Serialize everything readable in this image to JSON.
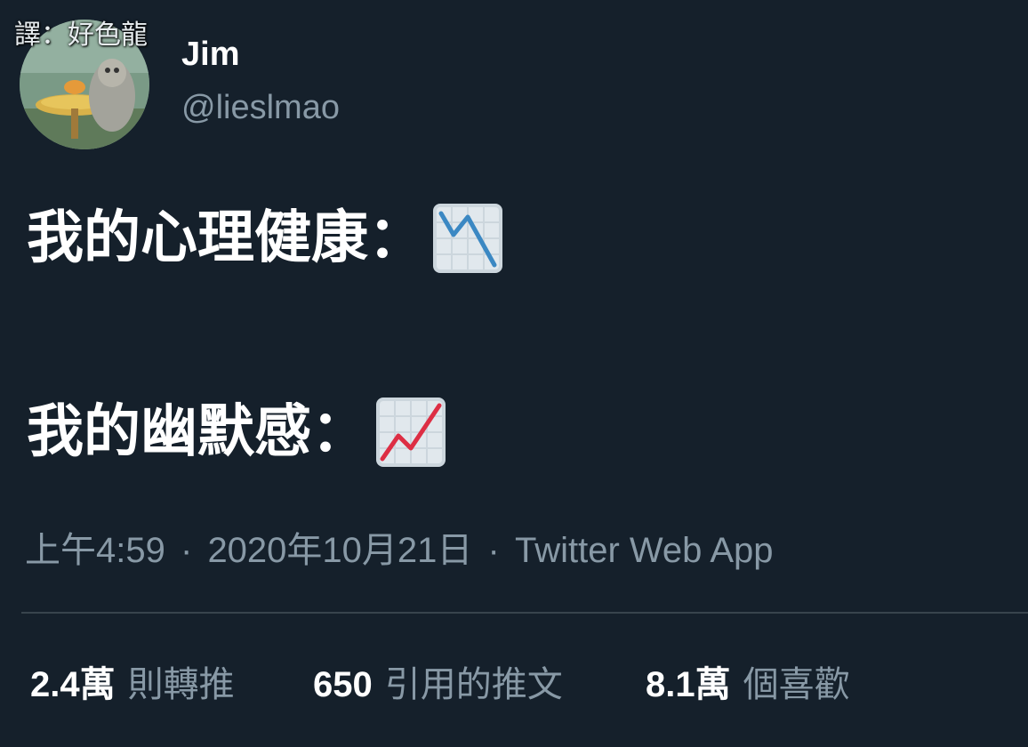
{
  "watermark": "譯：好色龍",
  "user": {
    "display_name": "Jim",
    "handle": "@lieslmao"
  },
  "tweet": {
    "line1": "我的心理健康：",
    "line1_emoji": "chart-decreasing-icon",
    "line2": "我的幽默感：",
    "line2_emoji": "chart-increasing-icon"
  },
  "meta": {
    "time": "上午4:59",
    "separator": "·",
    "date": "2020年10月21日",
    "source": "Twitter Web App"
  },
  "stats": {
    "retweets_count": "2.4萬",
    "retweets_label": "則轉推",
    "quotes_count": "650",
    "quotes_label": "引用的推文",
    "likes_count": "8.1萬",
    "likes_label": "個喜歡"
  },
  "colors": {
    "background": "#15202b",
    "secondary_text": "#8899a6",
    "divider": "#38444d",
    "chart_down": "#3b88c3",
    "chart_up": "#dd2e44"
  }
}
